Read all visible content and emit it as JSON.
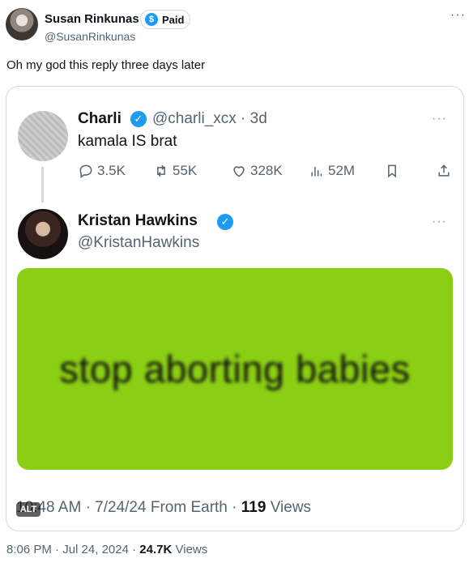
{
  "outer_tweet": {
    "author_name": "Susan Rinkunas",
    "paid_badge": "Paid",
    "paid_icon_glyph": "$",
    "handle": "@SusanRinkunas",
    "more": "···",
    "text": "Oh my god this reply three days later",
    "time": "8:06 PM",
    "separator": "·",
    "date": "Jul 24, 2024",
    "views_count": "24.7K",
    "views_label": "Views"
  },
  "quoted_tweet": {
    "more": "···",
    "original": {
      "author_name": "Charli",
      "handle": "@charli_xcx",
      "age": "3d",
      "text": "kamala IS brat",
      "replies": "3.5K",
      "reposts": "55K",
      "likes": "328K",
      "views": "52M"
    },
    "reply": {
      "author_name": "Kristan Hawkins",
      "handle": "@KristanHawkins",
      "image_text": "stop aborting babies",
      "image_bg_color": "#8bcf14",
      "alt_badge": "ALT",
      "time": "10:48 AM",
      "date": "7/24/24",
      "source": "From Earth",
      "views_count": "119",
      "views_label": "Views"
    }
  },
  "colors": {
    "accent": "#1d9bf0",
    "muted": "#536471",
    "border": "#cfd9de"
  },
  "icons": [
    "reply-icon",
    "repost-icon",
    "like-icon",
    "views-icon",
    "bookmark-icon",
    "share-icon",
    "verified-icon",
    "more-icon"
  ]
}
